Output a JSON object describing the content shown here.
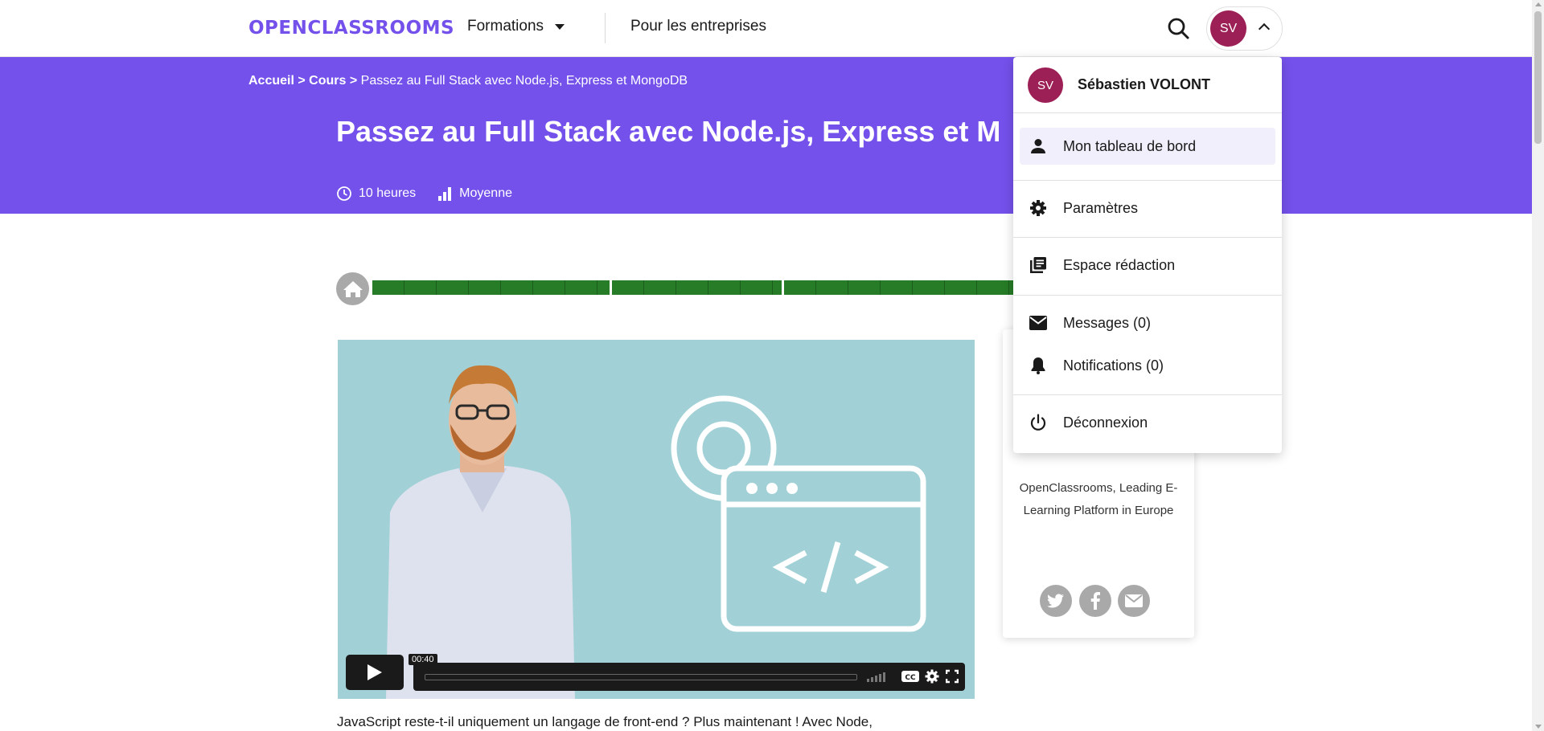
{
  "nav": {
    "logo": "OPENCLASSROOMS",
    "formations": "Formations",
    "entreprises": "Pour les entreprises",
    "avatar_initials": "SV"
  },
  "hero": {
    "breadcrumb": {
      "home": "Accueil",
      "courses": "Cours",
      "current": "Passez au Full Stack avec Node.js, Express et MongoDB"
    },
    "title": "Passez au Full Stack avec Node.js, Express et M",
    "duration": "10 heures",
    "difficulty": "Moyenne"
  },
  "video": {
    "time": "00:40",
    "progress": 0
  },
  "description": "JavaScript reste-t-il uniquement un langage de front-end ? Plus maintenant ! Avec Node,",
  "share": {
    "text": "OpenClassrooms, Leading E-Learning Platform in Europe"
  },
  "menu": {
    "user_name": "Sébastien VOLONT",
    "user_initials": "SV",
    "items": [
      {
        "label": "Mon tableau de bord",
        "icon": "person-icon"
      },
      {
        "label": "Paramètres",
        "icon": "gear-icon"
      },
      {
        "label": "Espace rédaction",
        "icon": "library-icon"
      },
      {
        "label": "Messages (0)",
        "icon": "mail-icon"
      },
      {
        "label": "Notifications (0)",
        "icon": "bell-icon"
      },
      {
        "label": "Déconnexion",
        "icon": "power-icon"
      }
    ]
  },
  "colors": {
    "brand": "#7451eb",
    "avatar": "#9c1f55",
    "progress": "#267c27"
  }
}
